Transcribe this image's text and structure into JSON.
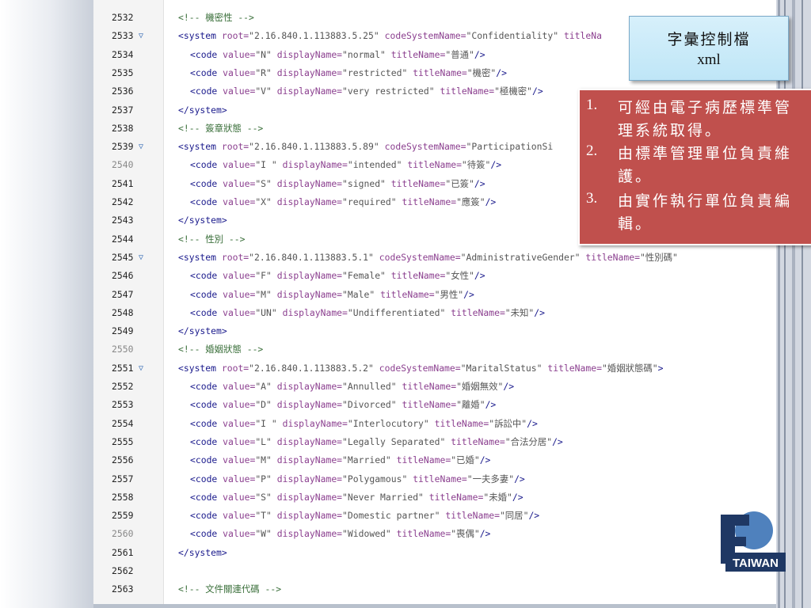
{
  "title_box": {
    "line1": "字彙控制檔",
    "line2": "xml"
  },
  "notes": [
    {
      "num": "1.",
      "text": "可經由電子病歷標準管理系統取得。"
    },
    {
      "num": "2.",
      "text": "由標準管理單位負責維護。"
    },
    {
      "num": "3.",
      "text": "由實作執行單位負責編輯。"
    }
  ],
  "logo": {
    "text": "TAIWAN"
  },
  "colors": {
    "note_bg": "#c0504d",
    "title_bg": "#c9eaf8",
    "tag": "#1a1a8c",
    "attr": "#8b3f8f"
  },
  "lines": [
    {
      "n": "2532",
      "fold": false,
      "dim": false,
      "indent": 0,
      "tokens": [
        [
          "cm",
          "<!-- 機密性 -->"
        ]
      ]
    },
    {
      "n": "2533",
      "fold": true,
      "dim": false,
      "indent": 0,
      "tokens": [
        [
          "tag",
          "<system "
        ],
        [
          "attr",
          "root="
        ],
        [
          "str",
          "\"2.16.840.1.113883.5.25\" "
        ],
        [
          "attr",
          "codeSystemName="
        ],
        [
          "str",
          "\"Confidentiality\" "
        ],
        [
          "attr",
          "titleNa"
        ]
      ]
    },
    {
      "n": "2534",
      "fold": false,
      "dim": false,
      "indent": 1,
      "tokens": [
        [
          "tag",
          "<code "
        ],
        [
          "attr",
          "value="
        ],
        [
          "str",
          "\"N\" "
        ],
        [
          "attr",
          "displayName="
        ],
        [
          "str",
          "\"normal\" "
        ],
        [
          "attr",
          "titleName="
        ],
        [
          "str",
          "\"普通\""
        ],
        [
          "tag",
          "/>"
        ]
      ]
    },
    {
      "n": "2535",
      "fold": false,
      "dim": false,
      "indent": 1,
      "tokens": [
        [
          "tag",
          "<code "
        ],
        [
          "attr",
          "value="
        ],
        [
          "str",
          "\"R\" "
        ],
        [
          "attr",
          "displayName="
        ],
        [
          "str",
          "\"restricted\" "
        ],
        [
          "attr",
          "titleName="
        ],
        [
          "str",
          "\"機密\""
        ],
        [
          "tag",
          "/>"
        ]
      ]
    },
    {
      "n": "2536",
      "fold": false,
      "dim": false,
      "indent": 1,
      "tokens": [
        [
          "tag",
          "<code "
        ],
        [
          "attr",
          "value="
        ],
        [
          "str",
          "\"V\" "
        ],
        [
          "attr",
          "displayName="
        ],
        [
          "str",
          "\"very restricted\" "
        ],
        [
          "attr",
          "titleName="
        ],
        [
          "str",
          "\"極機密\""
        ],
        [
          "tag",
          "/>"
        ]
      ]
    },
    {
      "n": "2537",
      "fold": false,
      "dim": false,
      "indent": 0,
      "tokens": [
        [
          "tag",
          "</system>"
        ]
      ]
    },
    {
      "n": "2538",
      "fold": false,
      "dim": false,
      "indent": 0,
      "tokens": [
        [
          "cm",
          "<!-- 簽章狀態 -->"
        ]
      ]
    },
    {
      "n": "2539",
      "fold": true,
      "dim": false,
      "indent": 0,
      "tokens": [
        [
          "tag",
          "<system "
        ],
        [
          "attr",
          "root="
        ],
        [
          "str",
          "\"2.16.840.1.113883.5.89\" "
        ],
        [
          "attr",
          "codeSystemName="
        ],
        [
          "str",
          "\"ParticipationSi"
        ]
      ]
    },
    {
      "n": "2540",
      "fold": false,
      "dim": true,
      "indent": 1,
      "tokens": [
        [
          "tag",
          "<code "
        ],
        [
          "attr",
          "value="
        ],
        [
          "str",
          "\"I \" "
        ],
        [
          "attr",
          "displayName="
        ],
        [
          "str",
          "\"intended\" "
        ],
        [
          "attr",
          "titleName="
        ],
        [
          "str",
          "\"待簽\""
        ],
        [
          "tag",
          "/>"
        ]
      ]
    },
    {
      "n": "2541",
      "fold": false,
      "dim": false,
      "indent": 1,
      "tokens": [
        [
          "tag",
          "<code "
        ],
        [
          "attr",
          "value="
        ],
        [
          "str",
          "\"S\" "
        ],
        [
          "attr",
          "displayName="
        ],
        [
          "str",
          "\"signed\" "
        ],
        [
          "attr",
          "titleName="
        ],
        [
          "str",
          "\"已簽\""
        ],
        [
          "tag",
          "/>"
        ]
      ]
    },
    {
      "n": "2542",
      "fold": false,
      "dim": false,
      "indent": 1,
      "tokens": [
        [
          "tag",
          "<code "
        ],
        [
          "attr",
          "value="
        ],
        [
          "str",
          "\"X\" "
        ],
        [
          "attr",
          "displayName="
        ],
        [
          "str",
          "\"required\" "
        ],
        [
          "attr",
          "titleName="
        ],
        [
          "str",
          "\"應簽\""
        ],
        [
          "tag",
          "/>"
        ]
      ]
    },
    {
      "n": "2543",
      "fold": false,
      "dim": false,
      "indent": 0,
      "tokens": [
        [
          "tag",
          "</system>"
        ]
      ]
    },
    {
      "n": "2544",
      "fold": false,
      "dim": false,
      "indent": 0,
      "tokens": [
        [
          "cm",
          "<!-- 性別 -->"
        ]
      ]
    },
    {
      "n": "2545",
      "fold": true,
      "dim": false,
      "indent": 0,
      "tokens": [
        [
          "tag",
          "<system "
        ],
        [
          "attr",
          "root="
        ],
        [
          "str",
          "\"2.16.840.1.113883.5.1\" "
        ],
        [
          "attr",
          "codeSystemName="
        ],
        [
          "str",
          "\"AdministrativeGender\" "
        ],
        [
          "attr",
          "titleName="
        ],
        [
          "str",
          "\"性別碼\""
        ]
      ]
    },
    {
      "n": "2546",
      "fold": false,
      "dim": false,
      "indent": 1,
      "tokens": [
        [
          "tag",
          "<code "
        ],
        [
          "attr",
          "value="
        ],
        [
          "str",
          "\"F\" "
        ],
        [
          "attr",
          "displayName="
        ],
        [
          "str",
          "\"Female\" "
        ],
        [
          "attr",
          "titleName="
        ],
        [
          "str",
          "\"女性\""
        ],
        [
          "tag",
          "/>"
        ]
      ]
    },
    {
      "n": "2547",
      "fold": false,
      "dim": false,
      "indent": 1,
      "tokens": [
        [
          "tag",
          "<code "
        ],
        [
          "attr",
          "value="
        ],
        [
          "str",
          "\"M\" "
        ],
        [
          "attr",
          "displayName="
        ],
        [
          "str",
          "\"Male\" "
        ],
        [
          "attr",
          "titleName="
        ],
        [
          "str",
          "\"男性\""
        ],
        [
          "tag",
          "/>"
        ]
      ]
    },
    {
      "n": "2548",
      "fold": false,
      "dim": false,
      "indent": 1,
      "tokens": [
        [
          "tag",
          "<code "
        ],
        [
          "attr",
          "value="
        ],
        [
          "str",
          "\"UN\" "
        ],
        [
          "attr",
          "displayName="
        ],
        [
          "str",
          "\"Undifferentiated\" "
        ],
        [
          "attr",
          "titleName="
        ],
        [
          "str",
          "\"未知\""
        ],
        [
          "tag",
          "/>"
        ]
      ]
    },
    {
      "n": "2549",
      "fold": false,
      "dim": false,
      "indent": 0,
      "tokens": [
        [
          "tag",
          "</system>"
        ]
      ]
    },
    {
      "n": "2550",
      "fold": false,
      "dim": true,
      "indent": 0,
      "tokens": [
        [
          "cm",
          "<!-- 婚姻狀態 -->"
        ]
      ]
    },
    {
      "n": "2551",
      "fold": true,
      "dim": false,
      "indent": 0,
      "tokens": [
        [
          "tag",
          "<system "
        ],
        [
          "attr",
          "root="
        ],
        [
          "str",
          "\"2.16.840.1.113883.5.2\" "
        ],
        [
          "attr",
          "codeSystemName="
        ],
        [
          "str",
          "\"MaritalStatus\" "
        ],
        [
          "attr",
          "titleName="
        ],
        [
          "str",
          "\"婚姻狀態碼\""
        ],
        [
          "tag",
          ">"
        ]
      ]
    },
    {
      "n": "2552",
      "fold": false,
      "dim": false,
      "indent": 1,
      "tokens": [
        [
          "tag",
          "<code "
        ],
        [
          "attr",
          "value="
        ],
        [
          "str",
          "\"A\" "
        ],
        [
          "attr",
          "displayName="
        ],
        [
          "str",
          "\"Annulled\" "
        ],
        [
          "attr",
          "titleName="
        ],
        [
          "str",
          "\"婚姻無效\""
        ],
        [
          "tag",
          "/>"
        ]
      ]
    },
    {
      "n": "2553",
      "fold": false,
      "dim": false,
      "indent": 1,
      "tokens": [
        [
          "tag",
          "<code "
        ],
        [
          "attr",
          "value="
        ],
        [
          "str",
          "\"D\" "
        ],
        [
          "attr",
          "displayName="
        ],
        [
          "str",
          "\"Divorced\" "
        ],
        [
          "attr",
          "titleName="
        ],
        [
          "str",
          "\"離婚\""
        ],
        [
          "tag",
          "/>"
        ]
      ]
    },
    {
      "n": "2554",
      "fold": false,
      "dim": false,
      "indent": 1,
      "tokens": [
        [
          "tag",
          "<code "
        ],
        [
          "attr",
          "value="
        ],
        [
          "str",
          "\"I \" "
        ],
        [
          "attr",
          "displayName="
        ],
        [
          "str",
          "\"Interlocutory\" "
        ],
        [
          "attr",
          "titleName="
        ],
        [
          "str",
          "\"訴訟中\""
        ],
        [
          "tag",
          "/>"
        ]
      ]
    },
    {
      "n": "2555",
      "fold": false,
      "dim": false,
      "indent": 1,
      "tokens": [
        [
          "tag",
          "<code "
        ],
        [
          "attr",
          "value="
        ],
        [
          "str",
          "\"L\" "
        ],
        [
          "attr",
          "displayName="
        ],
        [
          "str",
          "\"Legally Separated\" "
        ],
        [
          "attr",
          "titleName="
        ],
        [
          "str",
          "\"合法分居\""
        ],
        [
          "tag",
          "/>"
        ]
      ]
    },
    {
      "n": "2556",
      "fold": false,
      "dim": false,
      "indent": 1,
      "tokens": [
        [
          "tag",
          "<code "
        ],
        [
          "attr",
          "value="
        ],
        [
          "str",
          "\"M\" "
        ],
        [
          "attr",
          "displayName="
        ],
        [
          "str",
          "\"Married\" "
        ],
        [
          "attr",
          "titleName="
        ],
        [
          "str",
          "\"已婚\""
        ],
        [
          "tag",
          "/>"
        ]
      ]
    },
    {
      "n": "2557",
      "fold": false,
      "dim": false,
      "indent": 1,
      "tokens": [
        [
          "tag",
          "<code "
        ],
        [
          "attr",
          "value="
        ],
        [
          "str",
          "\"P\" "
        ],
        [
          "attr",
          "displayName="
        ],
        [
          "str",
          "\"Polygamous\" "
        ],
        [
          "attr",
          "titleName="
        ],
        [
          "str",
          "\"一夫多妻\""
        ],
        [
          "tag",
          "/>"
        ]
      ]
    },
    {
      "n": "2558",
      "fold": false,
      "dim": false,
      "indent": 1,
      "tokens": [
        [
          "tag",
          "<code "
        ],
        [
          "attr",
          "value="
        ],
        [
          "str",
          "\"S\" "
        ],
        [
          "attr",
          "displayName="
        ],
        [
          "str",
          "\"Never Married\" "
        ],
        [
          "attr",
          "titleName="
        ],
        [
          "str",
          "\"未婚\""
        ],
        [
          "tag",
          "/>"
        ]
      ]
    },
    {
      "n": "2559",
      "fold": false,
      "dim": false,
      "indent": 1,
      "tokens": [
        [
          "tag",
          "<code "
        ],
        [
          "attr",
          "value="
        ],
        [
          "str",
          "\"T\" "
        ],
        [
          "attr",
          "displayName="
        ],
        [
          "str",
          "\"Domestic partner\" "
        ],
        [
          "attr",
          "titleName="
        ],
        [
          "str",
          "\"同居\""
        ],
        [
          "tag",
          "/>"
        ]
      ]
    },
    {
      "n": "2560",
      "fold": false,
      "dim": true,
      "indent": 1,
      "tokens": [
        [
          "tag",
          "<code "
        ],
        [
          "attr",
          "value="
        ],
        [
          "str",
          "\"W\" "
        ],
        [
          "attr",
          "displayName="
        ],
        [
          "str",
          "\"Widowed\" "
        ],
        [
          "attr",
          "titleName="
        ],
        [
          "str",
          "\"喪偶\""
        ],
        [
          "tag",
          "/>"
        ]
      ]
    },
    {
      "n": "2561",
      "fold": false,
      "dim": false,
      "indent": 0,
      "tokens": [
        [
          "tag",
          "</system>"
        ]
      ]
    },
    {
      "n": "2562",
      "fold": false,
      "dim": false,
      "indent": 0,
      "tokens": []
    },
    {
      "n": "2563",
      "fold": false,
      "dim": false,
      "indent": 0,
      "tokens": [
        [
          "cm",
          "<!-- 文件關連代碼 -->"
        ]
      ]
    }
  ]
}
